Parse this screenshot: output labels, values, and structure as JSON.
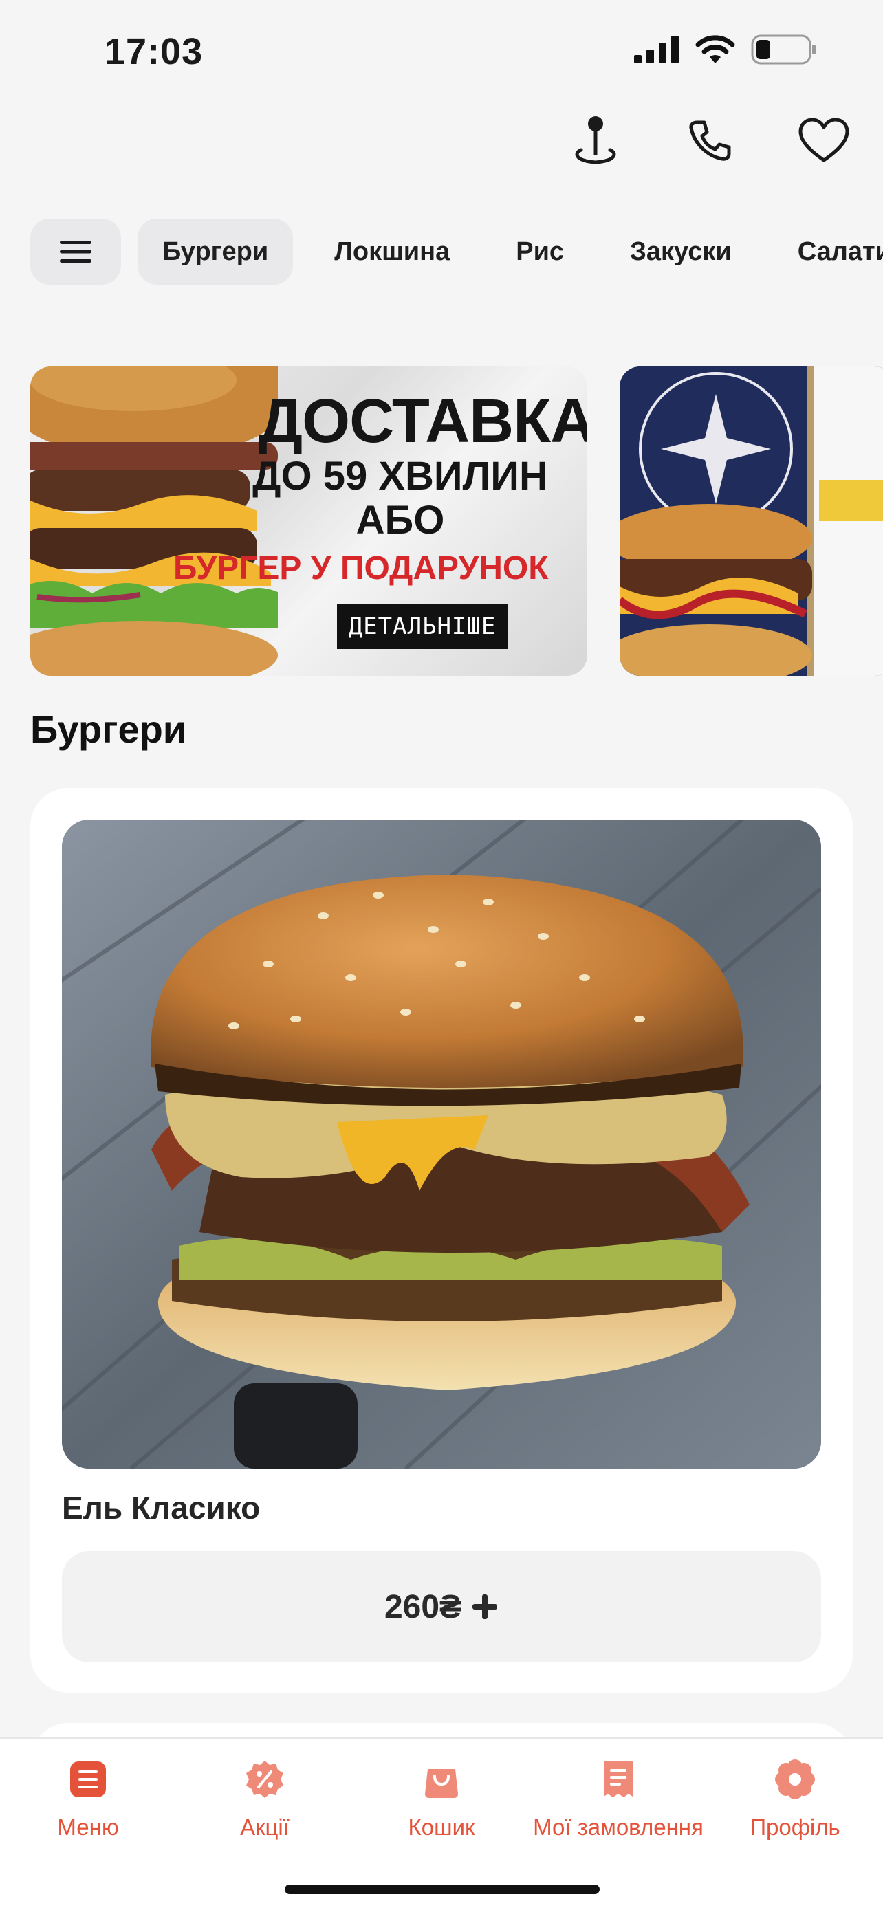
{
  "status": {
    "time": "17:03"
  },
  "header": {
    "icons": [
      "location-pin-icon",
      "phone-icon",
      "heart-icon"
    ]
  },
  "tabs": [
    {
      "label": "Бургери",
      "active": true
    },
    {
      "label": "Локшина",
      "active": false
    },
    {
      "label": "Рис",
      "active": false
    },
    {
      "label": "Закуски",
      "active": false
    },
    {
      "label": "Салати",
      "active": false
    }
  ],
  "banner": {
    "title": "ДОСТАВКА",
    "line1": "ДО 59 ХВИЛИН",
    "line2": "АБО",
    "promo": "БУРГЕР У ПОДАРУНОК",
    "button": "ДЕТАЛЬНІШЕ"
  },
  "section": {
    "title": "Бургери"
  },
  "product": {
    "name": "Ель Класико",
    "price": "260₴"
  },
  "nav": [
    {
      "label": "Меню",
      "icon": "menu-list-icon"
    },
    {
      "label": "Акції",
      "icon": "discount-icon"
    },
    {
      "label": "Кошик",
      "icon": "bag-icon"
    },
    {
      "label": "Мої замовлення",
      "icon": "receipt-icon"
    },
    {
      "label": "Профіль",
      "icon": "profile-icon"
    }
  ],
  "colors": {
    "accent": "#e5523a",
    "accent_light": "#f08a78"
  }
}
